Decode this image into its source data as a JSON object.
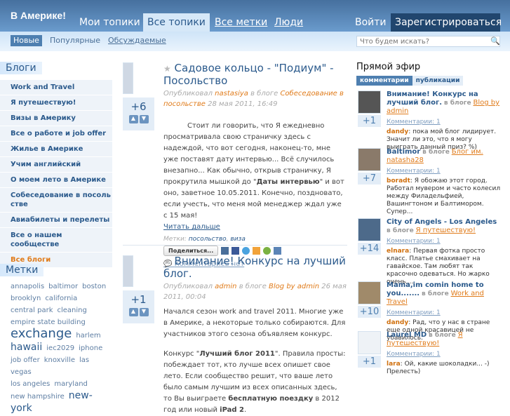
{
  "header": {
    "logo": "В Америке!",
    "nav": [
      "Мои топики",
      "Все топики",
      "Все метки",
      "Люди"
    ],
    "login": "Войти",
    "register": "Зарегистрироваться"
  },
  "subnav": {
    "items": [
      "Новые",
      "Популярные",
      "Обсуждаемые"
    ],
    "search_placeholder": "Что будем искать?"
  },
  "blogs": {
    "title": "Блоги",
    "items": [
      "Work and Travel",
      "Я путешествую!",
      "Визы в Америку",
      "Все о работе и job offer",
      "Жилье в Америке",
      "Учим английский",
      "О моем лето в Америке",
      "Собеседование в посольстве",
      "Авиабилеты и перелеты",
      "Все о нашем сообществе"
    ],
    "all": "Все блоги"
  },
  "tags": {
    "title": "Метки",
    "items": [
      "annapolis",
      "baltimor",
      "boston",
      "brooklyn",
      "california",
      "central park",
      "cleaning",
      "empire state building",
      "exchange",
      "harlem",
      "hawaii",
      "iec2029",
      "iphone",
      "job offer",
      "knoxville",
      "las vegas",
      "los angeles",
      "maryland",
      "new hampshire",
      "new-york"
    ]
  },
  "posts": [
    {
      "title": "Садовое кольцо - \"Подиум\" - Посольство",
      "rating": "+6",
      "published": "Опубликовал",
      "author": "nastasiya",
      "in_blog": "в блоге",
      "blog": "Собеседование в посольстве",
      "date": "28 мая 2011, 16:49",
      "text1": "Стоит ли говорить, что Я ежедневно просматривала свою страничку здесь с надеждой, что вот сегодня, наконец-то, мне уже поставят дату интервью... Всё случилось внезапно... Как обычно, открыв страничку, Я прокрутила мышкой до \"",
      "bold1": "Даты интервью",
      "text2": "\" и вот оно, заветное 10.05.2011. Конечно, поздновато, если учесть, что меня мой менеджер ждал уже с 15 мая!",
      "read_more": "Читать дальше",
      "tags_label": "Метки:",
      "tags": [
        "посольство",
        "виза"
      ],
      "share": "Поделиться...",
      "comments": "Комментариев нет"
    },
    {
      "title": "Внимание! Конкурс на лучший блог.",
      "rating": "+1",
      "published": "Опубликовал",
      "author": "admin",
      "in_blog": "в блоге",
      "blog": "Blog by admin",
      "date": "26 мая 2011, 00:04",
      "p1": "Начался сезон work and travel 2011. Многие уже в Америке, а некоторые только собираются. Для участников этого сезона объявляем конкурс.",
      "p2a": "Конкурс \"",
      "p2b": "Лучший блог 2011",
      "p2c": "\". Правила просты: побеждает тот, кто лучше всех опишет свое лето. Если сообщество решит, что ваше лето было самым лучшим из всех описанных здесь, то Вы выиграете ",
      "p2d": "бесплатную поездку",
      "p2e": " в 2012 год или новый ",
      "p2f": "iPad 2",
      "p2g": "."
    }
  ],
  "live": {
    "title": "Прямой эфир",
    "tabs": [
      "комментарии",
      "публикации"
    ],
    "in_blog": "в блоге",
    "items": [
      {
        "title": "Внимание! Конкурс на лучший блог.",
        "blog": "Blog by admin",
        "comments": "Комментарии: 1",
        "rating": "+1",
        "user": "dandy",
        "text": ": пока мой блог лидирует. Значит ли это, что я могу выиграть данный приз? %)"
      },
      {
        "title": "Baltimor",
        "blog": "Блог им. natasha28",
        "comments": "Комментарии: 1",
        "rating": "+7",
        "user": "boradt",
        "text": ": Я обожаю этот город. Работал мувером и часто колесил между Филадельфией, Вашингтоном и Балтимором. Супер..."
      },
      {
        "title": "City of Angels - Los Angeles",
        "blog": "Я путешествую!",
        "comments": "Комментарии: 1",
        "rating": "+14",
        "user": "elnara",
        "text": ": Первая фотка просто класс. Платье смахивает на гавайское. Там любят так красочно одеваться. Но жарко очень,..."
      },
      {
        "title": "Mama,im comin home to you.......",
        "blog": "Work and Travel",
        "comments": "Комментарии: 1",
        "rating": "+10",
        "user": "dandy",
        "text": ": Рад, что у нас в стране еще одной красавицей не убавилось."
      },
      {
        "title": "Laurel MD",
        "blog": "Я путешествую!",
        "comments": "Комментарии: 1",
        "rating": "+1",
        "user": "lara",
        "text": ": Ой, какие шоколадки... -) Прелесть)"
      }
    ]
  },
  "colors": {
    "accent": "#2b5a8c",
    "orange": "#e07b1a",
    "header": "#46709e"
  }
}
